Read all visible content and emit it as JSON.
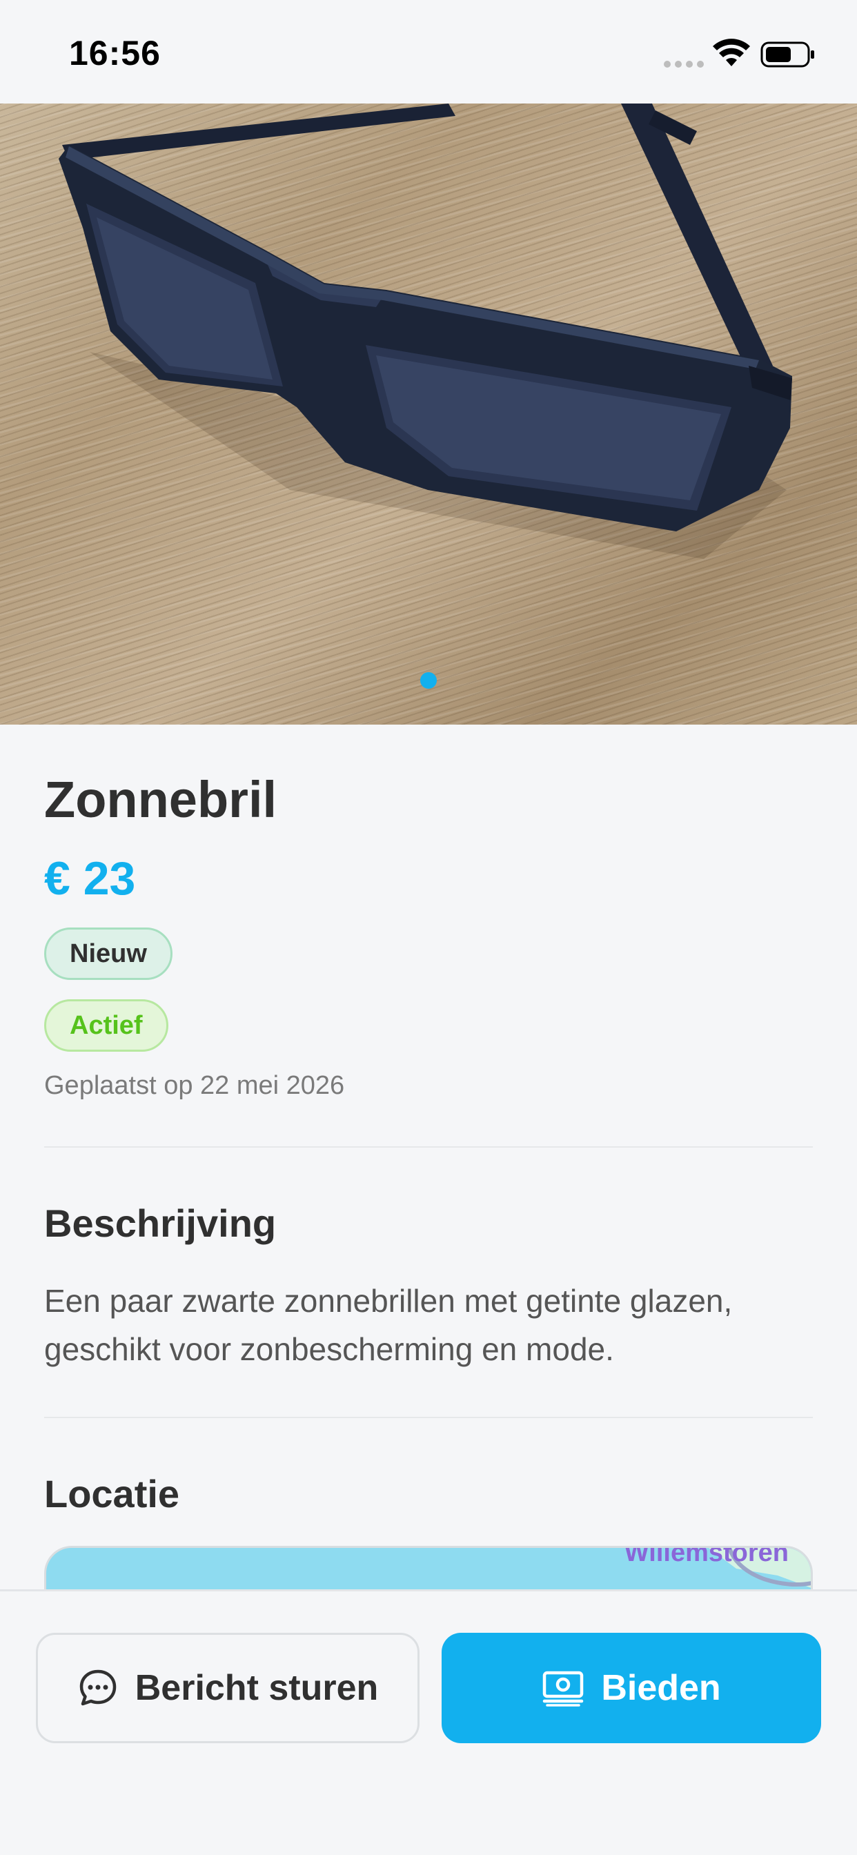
{
  "status_bar": {
    "time": "16:56"
  },
  "listing": {
    "title": "Zonnebril",
    "price": "€ 23",
    "condition_badge": "Nieuw",
    "status_badge": "Actief",
    "posted_text": "Geplaatst op 22 mei 2026",
    "image_page_count": 1,
    "image_current_page": 1
  },
  "description": {
    "heading": "Beschrijving",
    "text": "Een paar zwarte zonnebrillen met getinte glazen, geschikt voor zonbescherming en mode."
  },
  "location": {
    "heading": "Locatie",
    "map_label": "Willemstoren"
  },
  "actions": {
    "message_label": "Bericht sturen",
    "offer_label": "Bieden"
  },
  "colors": {
    "accent": "#12b0ee",
    "status_green": "#56c21b",
    "background": "#f5f6f8"
  },
  "icons": {
    "message": "chat-bubble-icon",
    "offer": "banknote-icon"
  }
}
